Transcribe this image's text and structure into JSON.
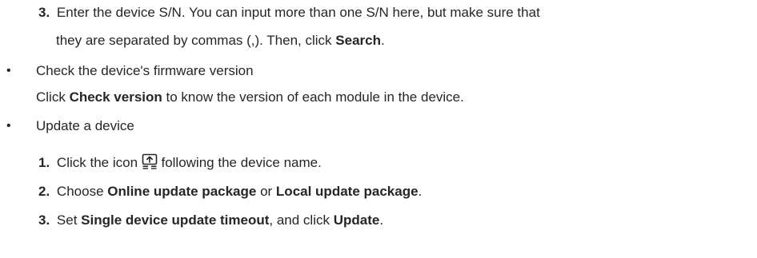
{
  "step3_search": {
    "number": "3.",
    "line1": "Enter the device S/N. You can input more than one S/N here, but make sure that",
    "line2_pre": "they are separated by commas (,). Then, click ",
    "line2_bold": "Search",
    "line2_post": "."
  },
  "check_firmware": {
    "bullet": "•",
    "title": "Check the device's firmware version",
    "desc_pre": "Click ",
    "desc_bold": "Check version",
    "desc_post": " to know the version of each module in the device."
  },
  "update_device": {
    "bullet": "•",
    "title": "Update a device",
    "steps": [
      {
        "number": "1.",
        "pre": "Click the icon ",
        "post": " following the device name.",
        "icon": "upload-icon"
      },
      {
        "number": "2.",
        "pre": "Choose ",
        "bold1": "Online update package",
        "mid": " or ",
        "bold2": "Local update package",
        "post": "."
      },
      {
        "number": "3.",
        "pre": "Set ",
        "bold1": "Single device update timeout",
        "mid": ", and click ",
        "bold2": "Update",
        "post": "."
      }
    ]
  }
}
